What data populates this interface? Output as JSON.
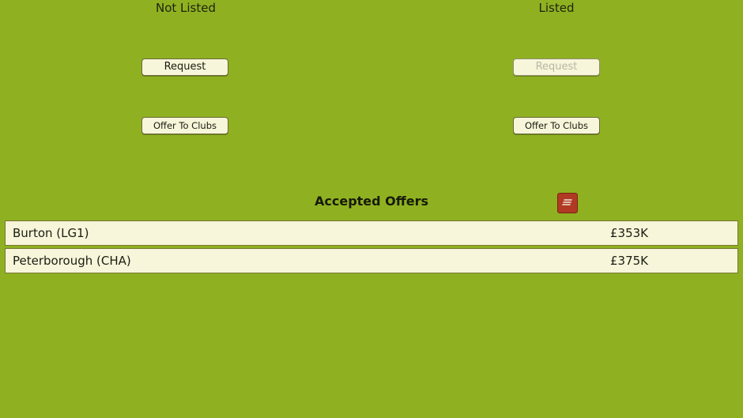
{
  "columns": {
    "not_listed": {
      "title": "Not Listed",
      "request_label": "Request",
      "offer_label": "Offer To Clubs"
    },
    "listed": {
      "title": "Listed",
      "request_label": "Request",
      "offer_label": "Offer To Clubs"
    }
  },
  "accepted_offers": {
    "title": "Accepted Offers",
    "notes_icon": "notes-icon",
    "rows": [
      {
        "club": "Burton (LG1)",
        "fee": "£353K"
      },
      {
        "club": "Peterborough (CHA)",
        "fee": "£375K"
      }
    ]
  },
  "colors": {
    "background": "#8fb121",
    "panel": "#f7f5da",
    "accent": "#b03a24"
  }
}
